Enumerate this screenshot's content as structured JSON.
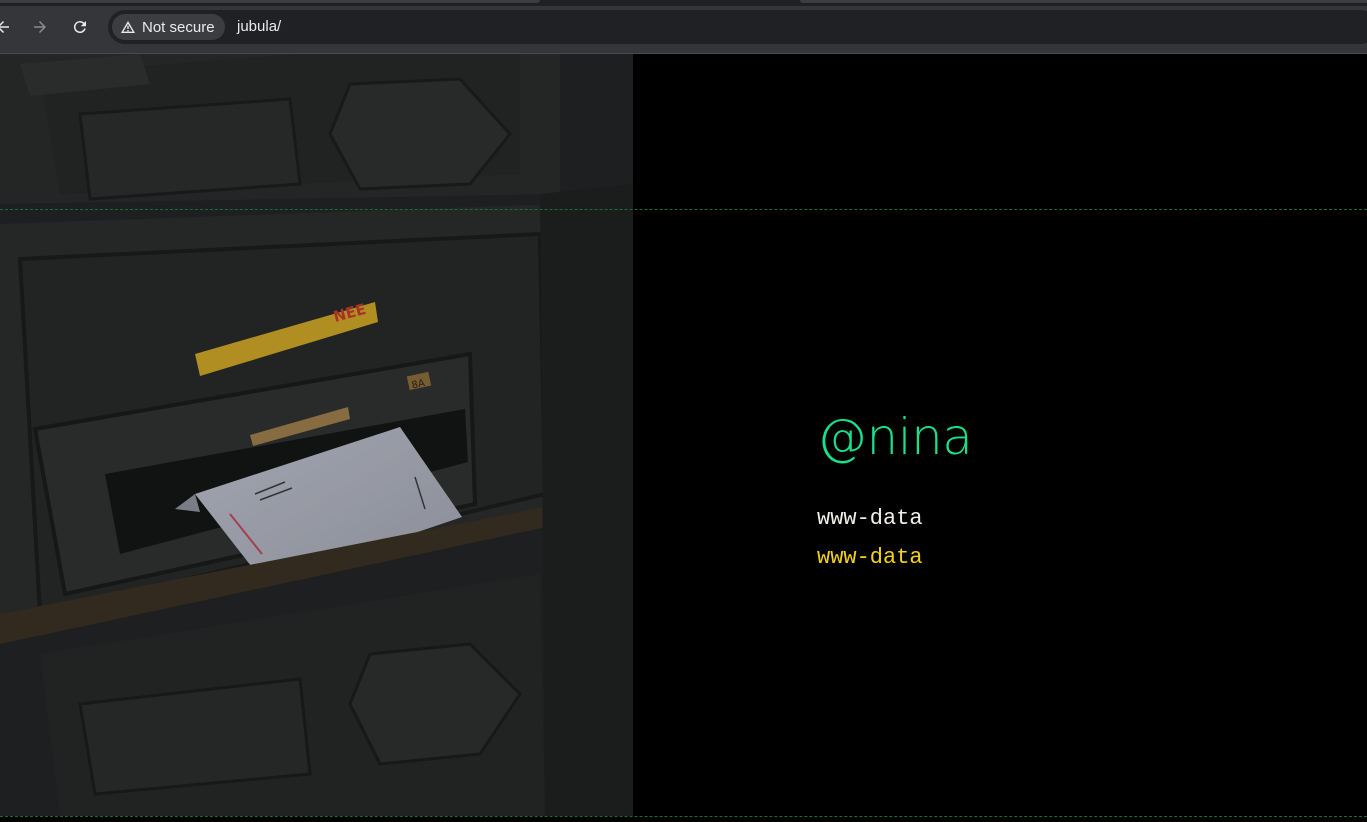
{
  "browser": {
    "security_label": "Not secure",
    "url": "jubula/"
  },
  "profile": {
    "handle": "@nina",
    "lines": [
      "www-data",
      "www-data"
    ]
  },
  "colors": {
    "handle": "#19e08a",
    "line1": "#f2efe6",
    "line2": "#f2d21a",
    "dash": "#1d6b35"
  },
  "photo": {
    "sticker_text": "NEE",
    "slot_number": "8A"
  }
}
